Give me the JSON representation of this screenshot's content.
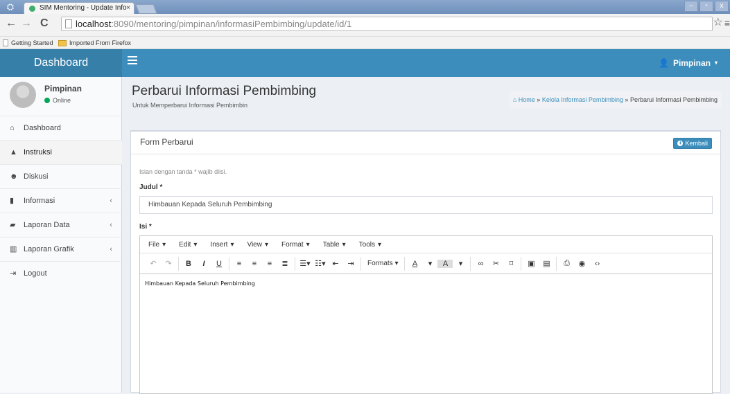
{
  "browser": {
    "tab_title": "SIM Mentoring - Update Info",
    "tab_close": "×",
    "url_host": "localhost",
    "url_rest": ":8090/mentoring/pimpinan/informasiPembimbing/update/id/1",
    "bookmarks": [
      {
        "label": "Getting Started",
        "icon": "page-icon"
      },
      {
        "label": "Imported From Firefox",
        "icon": "folder-icon"
      }
    ]
  },
  "header": {
    "logo": "Dashboard",
    "user_label": "Pimpinan"
  },
  "sidebar": {
    "user_name": "Pimpinan",
    "user_status": "Online",
    "items": [
      {
        "label": "Dashboard",
        "icon": "home-icon",
        "has_caret": false
      },
      {
        "label": "Instruksi",
        "icon": "warning-icon",
        "has_caret": false
      },
      {
        "label": "Diskusi",
        "icon": "users-icon",
        "has_caret": false
      },
      {
        "label": "Informasi",
        "icon": "file-icon",
        "has_caret": true
      },
      {
        "label": "Laporan Data",
        "icon": "book-icon",
        "has_caret": true
      },
      {
        "label": "Laporan Grafik",
        "icon": "bar-chart-icon",
        "has_caret": true
      },
      {
        "label": "Logout",
        "icon": "sign-out-icon",
        "has_caret": false
      }
    ]
  },
  "content": {
    "title": "Perbarui Informasi Pembimbing",
    "subtitle": "Untuk Memperbarui Informasi Pembimbin",
    "breadcrumb": {
      "home": "Home",
      "sep": "»",
      "link": "Kelola Informasi Pembimbing",
      "current": "Perbarui Informasi Pembimbing"
    }
  },
  "form": {
    "box_title": "Form Perbarui",
    "back_label": "Kembali",
    "note": "Isian dengan tanda * wajib diisi.",
    "judul_label": "Judul *",
    "judul_value": "Himbauan Kepada Seluruh Pembimbing",
    "isi_label": "Isi *",
    "isi_value": "Himbauan Kepada Seluruh Pembimbing"
  },
  "editor": {
    "menus": [
      "File",
      "Edit",
      "Insert",
      "View",
      "Format",
      "Table",
      "Tools"
    ],
    "formats_label": "Formats"
  },
  "colors": {
    "brand": "#3c8dbc",
    "brand_dark": "#367fa9",
    "online": "#00a65a"
  }
}
